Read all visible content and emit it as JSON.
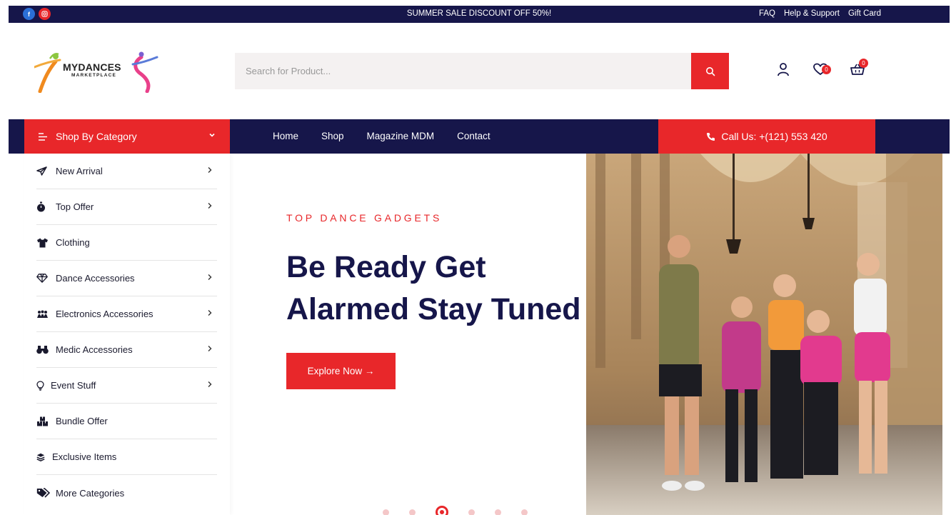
{
  "topbar": {
    "promo": "SUMMER SALE DISCOUNT OFF 50%!",
    "links": [
      "FAQ",
      "Help & Support",
      "Gift Card"
    ],
    "socials": [
      "facebook-icon",
      "instagram-icon"
    ]
  },
  "logo": {
    "line1": "MYDANCES",
    "line2": "MARKETPLACE"
  },
  "search": {
    "placeholder": "Search for Product..."
  },
  "header_icons": {
    "wishlist_count": "0",
    "cart_count": "0"
  },
  "nav": {
    "category_label": "Shop By Category",
    "menu": [
      "Home",
      "Shop",
      "Magazine MDM",
      "Contact"
    ],
    "call_label": "Call Us: +(121) 553 420"
  },
  "sidebar": {
    "items": [
      {
        "label": "New Arrival",
        "icon": "paper-plane-icon",
        "has_arrow": true
      },
      {
        "label": "Top Offer",
        "icon": "stopwatch-icon",
        "has_arrow": true
      },
      {
        "label": "Clothing",
        "icon": "tshirt-icon",
        "has_arrow": false
      },
      {
        "label": "Dance Accessories",
        "icon": "diamond-icon",
        "has_arrow": true
      },
      {
        "label": "Electronics Accessories",
        "icon": "people-icon",
        "has_arrow": true
      },
      {
        "label": "Medic Accessories",
        "icon": "binoculars-icon",
        "has_arrow": true
      },
      {
        "label": "Event Stuff",
        "icon": "lightbulb-icon",
        "has_arrow": true
      },
      {
        "label": "Bundle Offer",
        "icon": "boxes-icon",
        "has_arrow": false
      },
      {
        "label": "Exclusive Items",
        "icon": "layers-icon",
        "has_arrow": false
      },
      {
        "label": "More Categories",
        "icon": "tags-icon",
        "has_arrow": false
      }
    ]
  },
  "hero": {
    "kicker": "TOP DANCE GADGETS",
    "title_line1": "Be Ready Get",
    "title_line2": "Alarmed Stay Tuned",
    "button": "Explore Now →",
    "slide_count": 6,
    "active_slide": 3
  },
  "colors": {
    "navy": "#16164a",
    "red": "#e8272a"
  }
}
